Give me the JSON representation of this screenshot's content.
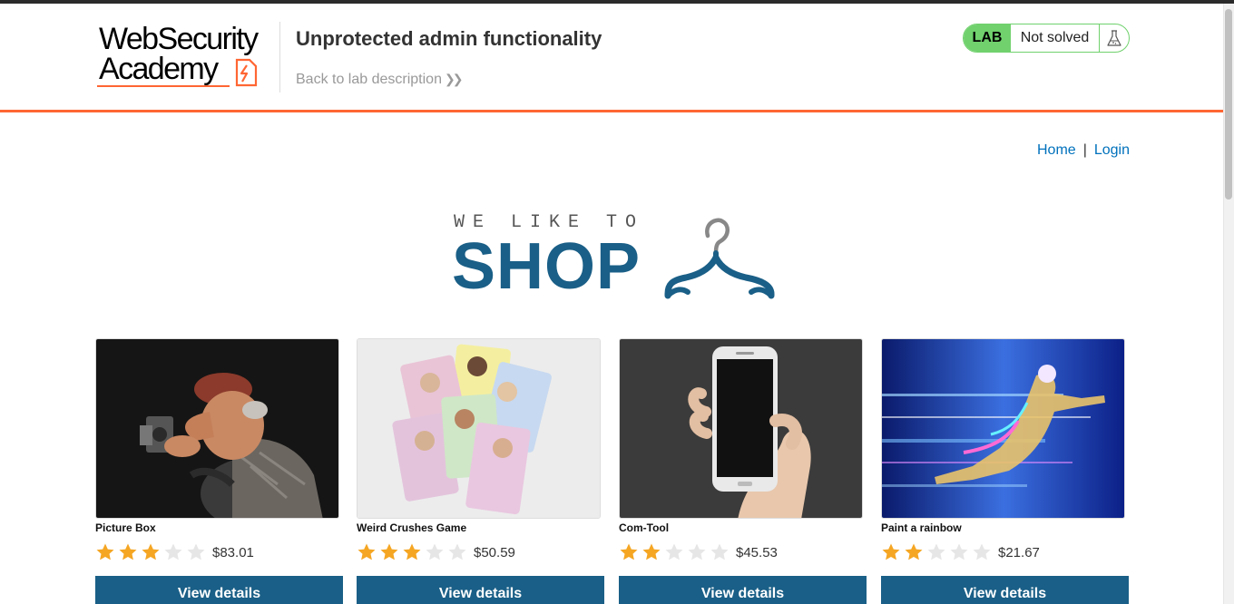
{
  "header": {
    "logo_line1": "WebSecurity",
    "logo_line2": "Academy",
    "lab_title": "Unprotected admin functionality",
    "back_link": "Back to lab description",
    "lab_badge": "LAB",
    "lab_status": "Not solved"
  },
  "nav": {
    "home": "Home",
    "separator": "|",
    "login": "Login"
  },
  "banner": {
    "small_text": "WE LIKE TO",
    "big_text": "SHOP"
  },
  "products": [
    {
      "name": "Picture Box",
      "rating": 3,
      "max_rating": 5,
      "price": "$83.01",
      "button": "View details",
      "image": "caricature-photographer-figurine"
    },
    {
      "name": "Weird Crushes Game",
      "rating": 3,
      "max_rating": 5,
      "price": "$50.59",
      "button": "View details",
      "image": "celebrity-trading-cards"
    },
    {
      "name": "Com-Tool",
      "rating": 2,
      "max_rating": 5,
      "price": "$45.53",
      "button": "View details",
      "image": "hand-holding-smartphone"
    },
    {
      "name": "Paint a rainbow",
      "rating": 2,
      "max_rating": 5,
      "price": "$21.67",
      "button": "View details",
      "image": "neon-speed-runner"
    }
  ],
  "colors": {
    "brand_orange": "#ff6633",
    "lab_green": "#70d16d",
    "primary_blue": "#1a5f87",
    "link_blue": "#0071bc",
    "star_filled": "#f5a623",
    "star_empty": "#e6e6e6"
  }
}
